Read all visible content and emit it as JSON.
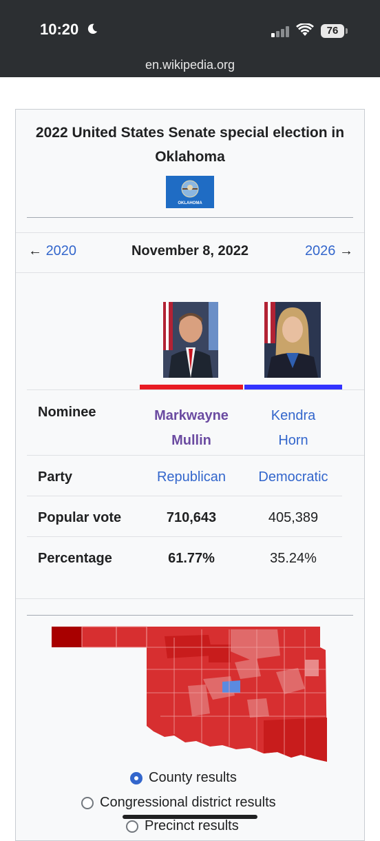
{
  "status_bar": {
    "time": "10:20",
    "battery": "76",
    "url": "en.wikipedia.org"
  },
  "infobox": {
    "title": "2022 United States Senate special election in Oklahoma",
    "flag_text": "OKLAHOMA",
    "nav": {
      "prev": "2020",
      "date": "November 8, 2022",
      "next": "2026",
      "prev_arrow": "←",
      "next_arrow": "→"
    },
    "rows": {
      "nominee_label": "Nominee",
      "party_label": "Party",
      "popular_vote_label": "Popular vote",
      "percentage_label": "Percentage"
    },
    "candidates": [
      {
        "name_line1": "Markwayne",
        "name_line2": "Mullin",
        "party": "Republican",
        "popular_vote": "710,643",
        "percentage": "61.77%",
        "color": "#e81b23"
      },
      {
        "name_line1": "Kendra",
        "name_line2": "Horn",
        "party": "Democratic",
        "popular_vote": "405,389",
        "percentage": "35.24%",
        "color": "#3333ff"
      }
    ],
    "map_options": [
      {
        "label": "County results",
        "selected": true
      },
      {
        "label": "Congressional district results",
        "selected": false
      },
      {
        "label": "Precinct results",
        "selected": false
      }
    ]
  }
}
